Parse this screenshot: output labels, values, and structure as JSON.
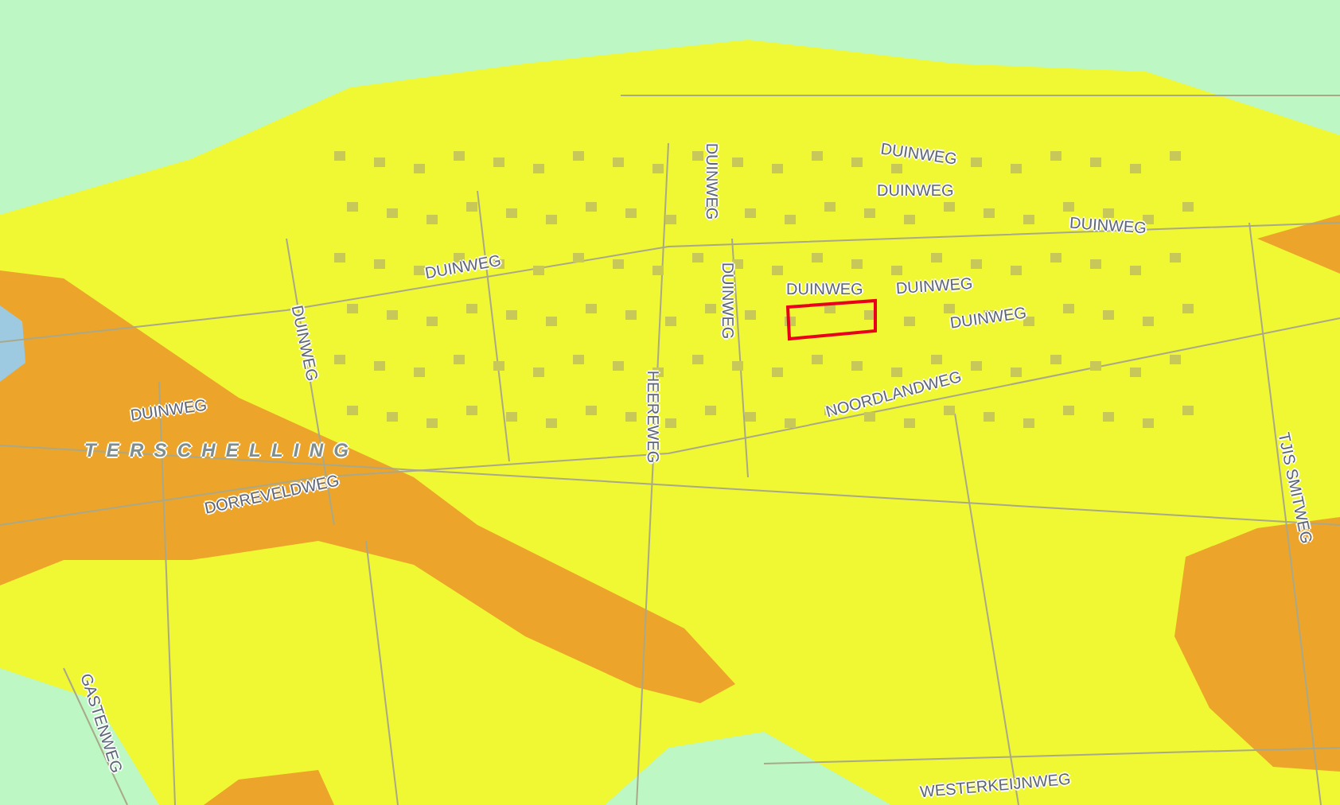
{
  "map": {
    "labels": [
      {
        "kind": "street",
        "text": "DUINWEG"
      },
      {
        "kind": "street",
        "text": "DUINWEG"
      },
      {
        "kind": "street",
        "text": "DUINWEG"
      },
      {
        "kind": "street",
        "text": "DUINWEG"
      },
      {
        "kind": "street",
        "text": "DUINWEG"
      },
      {
        "kind": "street",
        "text": "DUINWEG"
      },
      {
        "kind": "street",
        "text": "DUINWEG"
      },
      {
        "kind": "street",
        "text": "DUINWEG"
      },
      {
        "kind": "street",
        "text": "DUINWEG"
      },
      {
        "kind": "street",
        "text": "DUINWEG"
      },
      {
        "kind": "street",
        "text": "NOORDLANDWEG"
      },
      {
        "kind": "street",
        "text": "HEEREWEG"
      },
      {
        "kind": "street",
        "text": "TJIS SMITWEG"
      },
      {
        "kind": "street",
        "text": "DUINWEG"
      },
      {
        "kind": "place",
        "text": "TERSCHELLING"
      },
      {
        "kind": "street",
        "text": "DORREVELDWEG"
      },
      {
        "kind": "street",
        "text": "GASTENWEG"
      },
      {
        "kind": "street",
        "text": "WESTERKEIJNWEG"
      }
    ]
  }
}
